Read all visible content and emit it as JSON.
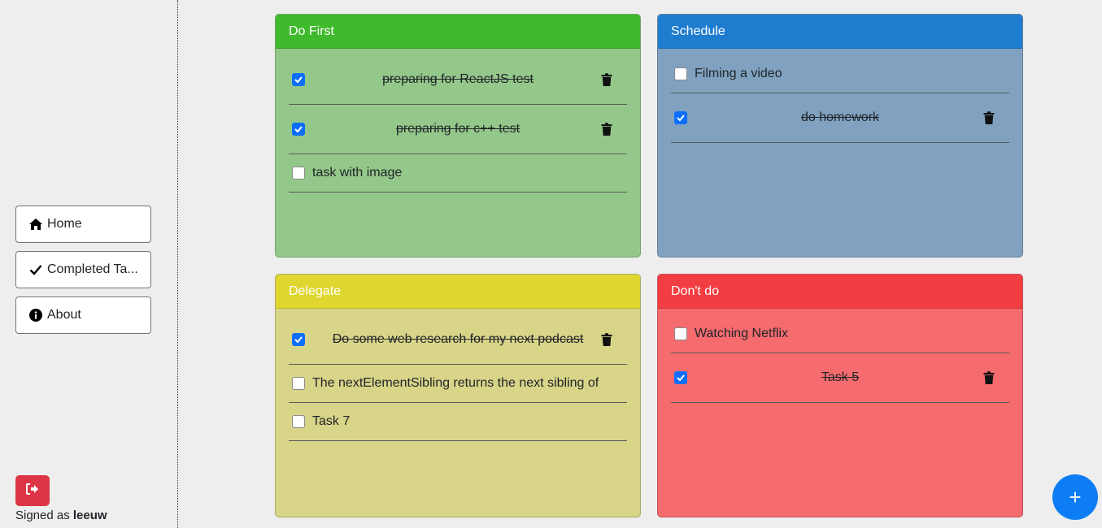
{
  "sidebar": {
    "nav": [
      {
        "label": "Home",
        "icon": "home-icon"
      },
      {
        "label": "Completed Ta...",
        "icon": "check-icon"
      },
      {
        "label": "About",
        "icon": "info-circle-icon"
      }
    ],
    "signed_prefix": "Signed as",
    "username": "leeuw",
    "logout_icon": "sign-out-icon",
    "logout_color": "#dc3545"
  },
  "quadrants": {
    "do_first": {
      "title": "Do First",
      "header_color": "#3fba2c",
      "body_color": "#94c88a",
      "tasks": [
        {
          "text": "preparing for ReactJS test",
          "done": true
        },
        {
          "text": "preparing for c++ test",
          "done": true
        },
        {
          "text": "task with image",
          "done": false
        }
      ]
    },
    "schedule": {
      "title": "Schedule",
      "header_color": "#1f7dd0",
      "body_color": "#80a2c0",
      "tasks": [
        {
          "text": "Filming a video",
          "done": false
        },
        {
          "text": "do homework",
          "done": true
        }
      ]
    },
    "delegate": {
      "title": "Delegate",
      "header_color": "#dfd72f",
      "body_color": "#d8d488",
      "tasks": [
        {
          "text": "Do some web research for my next podcast",
          "done": true
        },
        {
          "text": "The nextElementSibling returns the next sibling of",
          "done": false
        },
        {
          "text": "Task 7",
          "done": false
        }
      ]
    },
    "dont_do": {
      "title": "Don't do",
      "header_color": "#f23e42",
      "body_color": "#f56b6e",
      "tasks": [
        {
          "text": "Watching Netflix",
          "done": false
        },
        {
          "text": "Task 5",
          "done": true
        }
      ]
    }
  },
  "fab": {
    "label": "+",
    "color": "#0d7df5"
  }
}
